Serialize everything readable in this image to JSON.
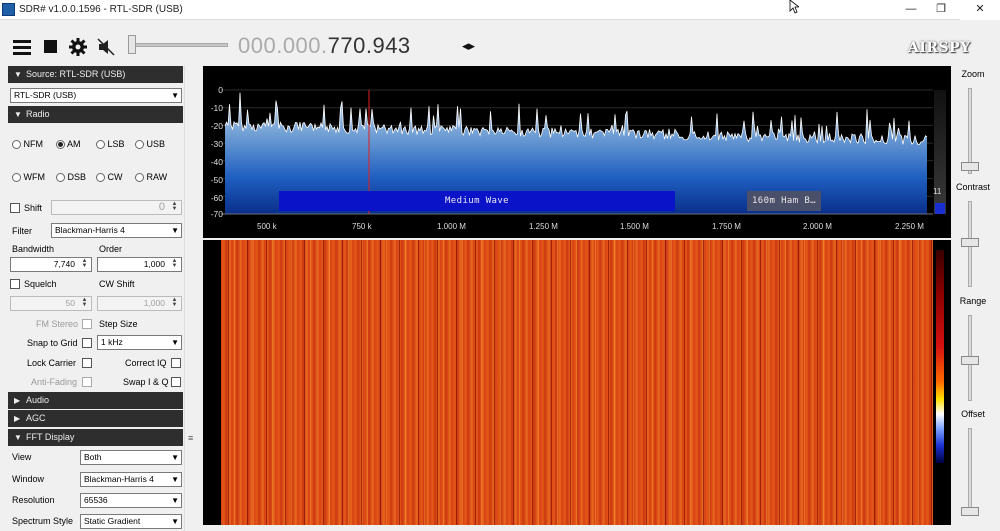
{
  "window": {
    "title": "SDR# v1.0.0.1596 - RTL-SDR (USB)",
    "minimize": "—",
    "maximize": "❐",
    "close": "✕"
  },
  "toolbar": {
    "frequency_dim": "000.000.",
    "frequency_lit": "770.943",
    "freq_arrows": "◂▸",
    "logo": "AIRSPY"
  },
  "source": {
    "header": "Source: RTL-SDR (USB)",
    "device": "RTL-SDR (USB)"
  },
  "radio": {
    "header": "Radio",
    "modes": [
      "NFM",
      "AM",
      "LSB",
      "USB",
      "WFM",
      "DSB",
      "CW",
      "RAW"
    ],
    "selected_mode": "AM",
    "shift_label": "Shift",
    "shift_value": "0",
    "filter_label": "Filter",
    "filter_value": "Blackman-Harris 4",
    "bandwidth_label": "Bandwidth",
    "bandwidth_value": "7,740",
    "order_label": "Order",
    "order_value": "1,000",
    "squelch_label": "Squelch",
    "squelch_value": "50",
    "cw_shift_label": "CW Shift",
    "cw_shift_value": "1,000",
    "fm_stereo_label": "FM Stereo",
    "step_size_label": "Step Size",
    "snap_to_grid_label": "Snap to Grid",
    "step_size_value": "1 kHz",
    "lock_carrier_label": "Lock Carrier",
    "correct_iq_label": "Correct IQ",
    "anti_fading_label": "Anti-Fading",
    "swap_iq_label": "Swap I & Q"
  },
  "audio": {
    "header": "Audio"
  },
  "agc": {
    "header": "AGC"
  },
  "fft": {
    "header": "FFT Display",
    "view_label": "View",
    "view_value": "Both",
    "window_label": "Window",
    "window_value": "Blackman-Harris 4",
    "resolution_label": "Resolution",
    "resolution_value": "65536",
    "spectrum_style_label": "Spectrum Style",
    "spectrum_style_value": "Static Gradient"
  },
  "spectrum": {
    "y_ticks": [
      "0",
      "-10",
      "-20",
      "-30",
      "-40",
      "-50",
      "-60",
      "-70"
    ],
    "x_ticks": [
      "500 k",
      "750 k",
      "1.000 M",
      "1.250 M",
      "1.500 M",
      "1.750 M",
      "2.000 M",
      "2.250 M"
    ],
    "bands": [
      "Medium Wave",
      "160m Ham B…"
    ],
    "level_readout": "11"
  },
  "right_panel": {
    "zoom": "Zoom",
    "contrast": "Contrast",
    "range": "Range",
    "offset": "Offset"
  },
  "colors": {
    "spectrum_fill_top": "#a9c4e3",
    "spectrum_fill_bottom": "#0a2f8a",
    "band_medium_wave": "#0a13c8",
    "band_ham": "#4a4f6a",
    "tuned_line": "#e02020",
    "waterfall_base": "#d43c14"
  }
}
